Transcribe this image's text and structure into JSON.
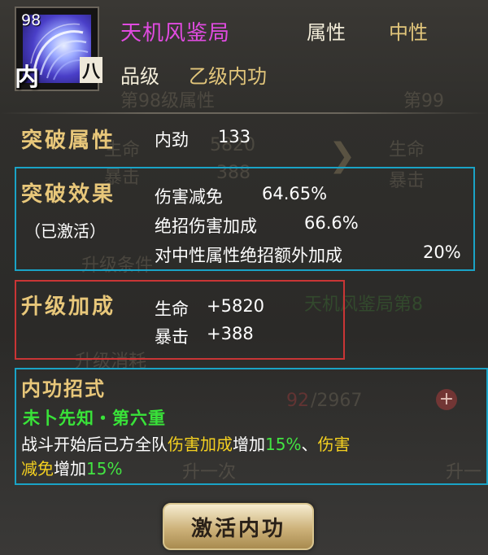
{
  "header": {
    "level": "98",
    "title": "天机风鉴局",
    "attribute_label": "属性",
    "attribute_value": "中性",
    "grade_label": "品级",
    "grade_value": "乙级内功",
    "type_badge": "内",
    "element_badge": "八"
  },
  "background_ghost": {
    "level_attr": "第98级属性",
    "next_level": "第99",
    "stat1": "生命",
    "stat1_value": "5820",
    "stat2": "暴击",
    "stat2_value": "388",
    "stat1_right": "生命",
    "stat2_right": "暴击",
    "upgrade_condition": "升级条件",
    "condition_text": "天机风鉴局第8",
    "upgrade_cost": "升级消耗",
    "cost_current": "92",
    "cost_total": "/2967",
    "upgrade_once": "升一次",
    "upgrade_once_right": "升一"
  },
  "breakthrough_attr": {
    "heading": "突破属性",
    "stat_name": "内劲",
    "stat_value": "133"
  },
  "breakthrough_effect": {
    "heading": "突破效果",
    "status": "（已激活）",
    "lines": [
      {
        "name": "伤害减免",
        "value": "64.65%"
      },
      {
        "name": "绝招伤害加成",
        "value": "66.6%"
      },
      {
        "name": "对中性属性绝招额外加成",
        "value": "20%"
      }
    ]
  },
  "upgrade_bonus": {
    "heading": "升级加成",
    "lines": [
      {
        "name": "生命",
        "value": "+5820"
      },
      {
        "name": "暴击",
        "value": "+388"
      }
    ]
  },
  "skill": {
    "heading": "内功招式",
    "name": "未卜先知・第六重",
    "desc_part1": "战斗开始后己方全队",
    "desc_hl1": "伤害加成",
    "desc_part2": "增加",
    "desc_pct1": "15%",
    "desc_part3": "、",
    "desc_hl2a": "伤害",
    "desc_hl2b": "减免",
    "desc_part4": "增加",
    "desc_pct2": "15%"
  },
  "activate_button": "激活内功",
  "colors": {
    "title": "#e04be0",
    "heading": "#e8c77a",
    "highlight_yellow": "#f4d020",
    "highlight_green": "#42e442",
    "skill_name": "#39e339",
    "box_cyan": "#1aa3c6",
    "box_red": "#c93535"
  },
  "icons": {
    "skill_icon": "wind-swirl-icon"
  }
}
